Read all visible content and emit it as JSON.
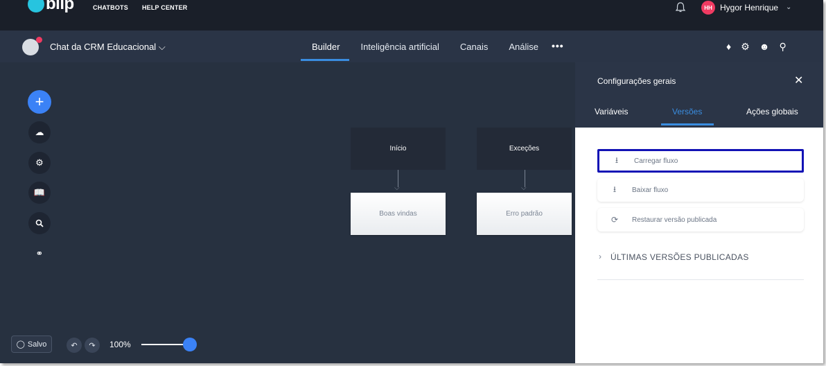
{
  "topbar": {
    "logo_text": "blip",
    "nav": [
      "CHATBOTS",
      "HELP CENTER"
    ],
    "user_initials": "HH",
    "user_name": "Hygor Henrique"
  },
  "bot": {
    "name": "Chat da CRM Educacional",
    "tabs": [
      "Builder",
      "Inteligência artificial",
      "Canais",
      "Análise"
    ],
    "more": "•••"
  },
  "canvas": {
    "blocks": [
      {
        "label": "Início"
      },
      {
        "label": "Exceções"
      },
      {
        "label": "Boas vindas"
      },
      {
        "label": "Erro padrão"
      }
    ]
  },
  "bottom": {
    "saved_label": "Salvo",
    "zoom": "100%",
    "zoom_level": 1.0
  },
  "panel": {
    "title": "Configurações gerais",
    "tabs": [
      "Variáveis",
      "Versões",
      "Ações globais"
    ],
    "active_tab": "Versões",
    "actions": [
      {
        "label": "Carregar fluxo",
        "icon": "upload-icon"
      },
      {
        "label": "Baixar fluxo",
        "icon": "download-icon"
      },
      {
        "label": "Restaurar versão publicada",
        "icon": "restore-icon"
      }
    ],
    "versions_header": "ÚLTIMAS VERSÕES PUBLICADAS"
  },
  "colors": {
    "accent": "#3a8de0",
    "canvas_bg": "#273140",
    "selection_outline": "#1212b5",
    "avatar": "#ef3b62"
  }
}
